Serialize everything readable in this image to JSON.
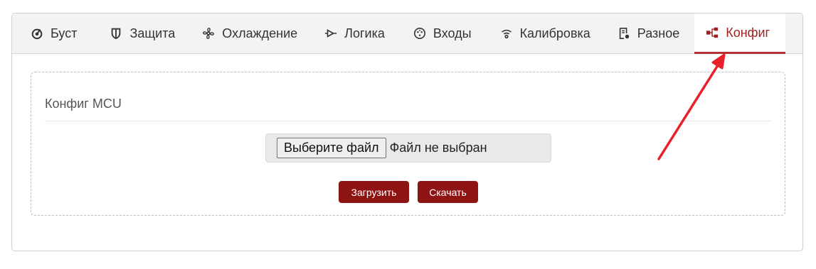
{
  "tabs": [
    {
      "label": "Буст",
      "icon": "gauge-icon"
    },
    {
      "label": "Защита",
      "icon": "shield-icon"
    },
    {
      "label": "Охлаждение",
      "icon": "fan-icon"
    },
    {
      "label": "Логика",
      "icon": "logic-gate-icon"
    },
    {
      "label": "Входы",
      "icon": "connector-icon"
    },
    {
      "label": "Калибровка",
      "icon": "signal-icon"
    },
    {
      "label": "Разное",
      "icon": "document-gear-icon"
    },
    {
      "label": "Конфиг",
      "icon": "sitemap-icon",
      "active": true
    }
  ],
  "config_card": {
    "title": "Конфиг MCU",
    "file_button_label": "Выберите файл",
    "file_status": "Файл не выбран",
    "upload_label": "Загрузить",
    "download_label": "Скачать"
  },
  "colors": {
    "accent": "#9c2121",
    "button_bg": "#8e1414",
    "annotation_arrow": "#e8202a"
  }
}
